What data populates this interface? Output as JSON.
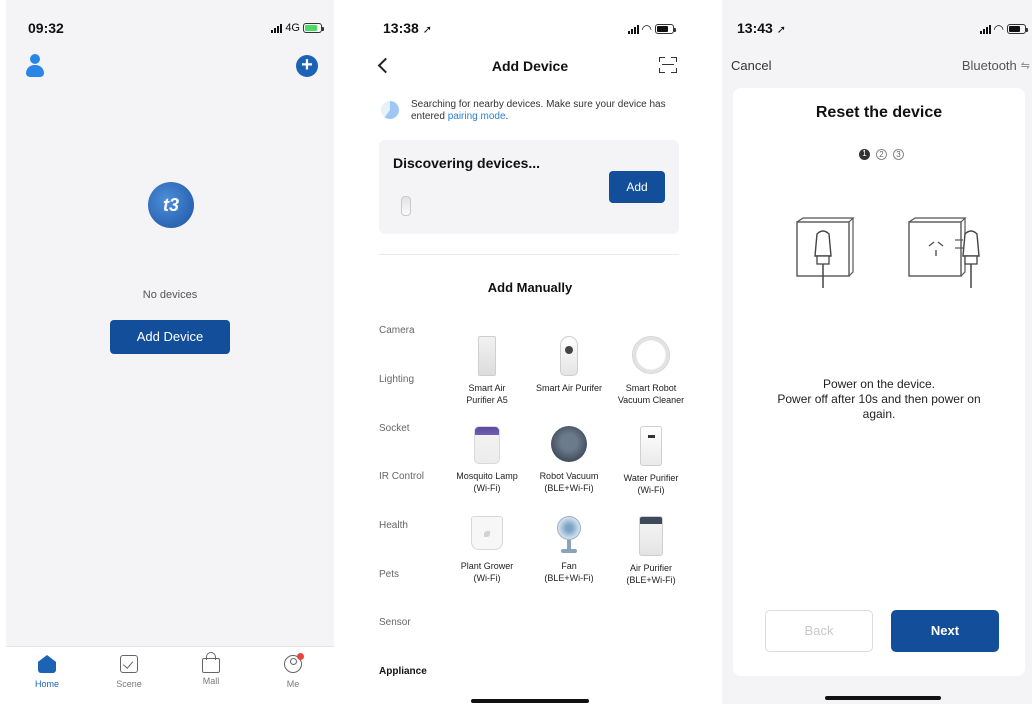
{
  "home_screen": {
    "time": "09:32",
    "network": "4G",
    "empty_text": "No devices",
    "add_button": "Add Device",
    "logo_text": "t3",
    "tabs": [
      {
        "label": "Home",
        "icon": "home-icon",
        "active": true
      },
      {
        "label": "Scene",
        "icon": "scene-icon",
        "active": false
      },
      {
        "label": "Mall",
        "icon": "mall-bag-icon",
        "active": false
      },
      {
        "label": "Me",
        "icon": "profile-icon",
        "active": false
      }
    ]
  },
  "add_device_screen": {
    "time": "13:38",
    "title": "Add Device",
    "info_prefix": "Searching for nearby devices. Make sure your device has entered",
    "info_link": "pairing mode",
    "info_suffix": ".",
    "discovering_title": "Discovering devices...",
    "add_button": "Add",
    "manual_title": "Add Manually",
    "categories": [
      "Camera",
      "Lighting",
      "Socket",
      "IR Control",
      "Health",
      "Pets",
      "Sensor",
      "Appliance"
    ],
    "devices": [
      {
        "line1": "Smart Air",
        "line2": "Purifier A5"
      },
      {
        "line1": "Smart Air Purifer",
        "line2": ""
      },
      {
        "line1": "Smart Robot",
        "line2": "Vacuum Cleaner"
      },
      {
        "line1": "Mosquito Lamp",
        "line2": "(Wi-Fi)"
      },
      {
        "line1": "Robot Vacuum",
        "line2": "(BLE+Wi-Fi)"
      },
      {
        "line1": "Water Purifier",
        "line2": "(Wi-Fi)"
      },
      {
        "line1": "Plant Grower",
        "line2": "(Wi-Fi)"
      },
      {
        "line1": "Fan",
        "line2": "(BLE+Wi-Fi)"
      },
      {
        "line1": "Air Purifier",
        "line2": "(BLE+Wi-Fi)"
      }
    ]
  },
  "reset_screen": {
    "time": "13:43",
    "cancel": "Cancel",
    "mode": "Bluetooth",
    "title": "Reset the device",
    "steps": [
      "1",
      "2",
      "3"
    ],
    "current_step": 1,
    "line1": "Power on the device.",
    "line2": "Power off after 10s and then power on",
    "line3": "again.",
    "back_button": "Back",
    "next_button": "Next"
  },
  "colors": {
    "brand_blue": "#124e99",
    "accent_blue": "#1d63b5",
    "link_blue": "#2b7fd3",
    "screen_gray": "#f4f4f6"
  }
}
